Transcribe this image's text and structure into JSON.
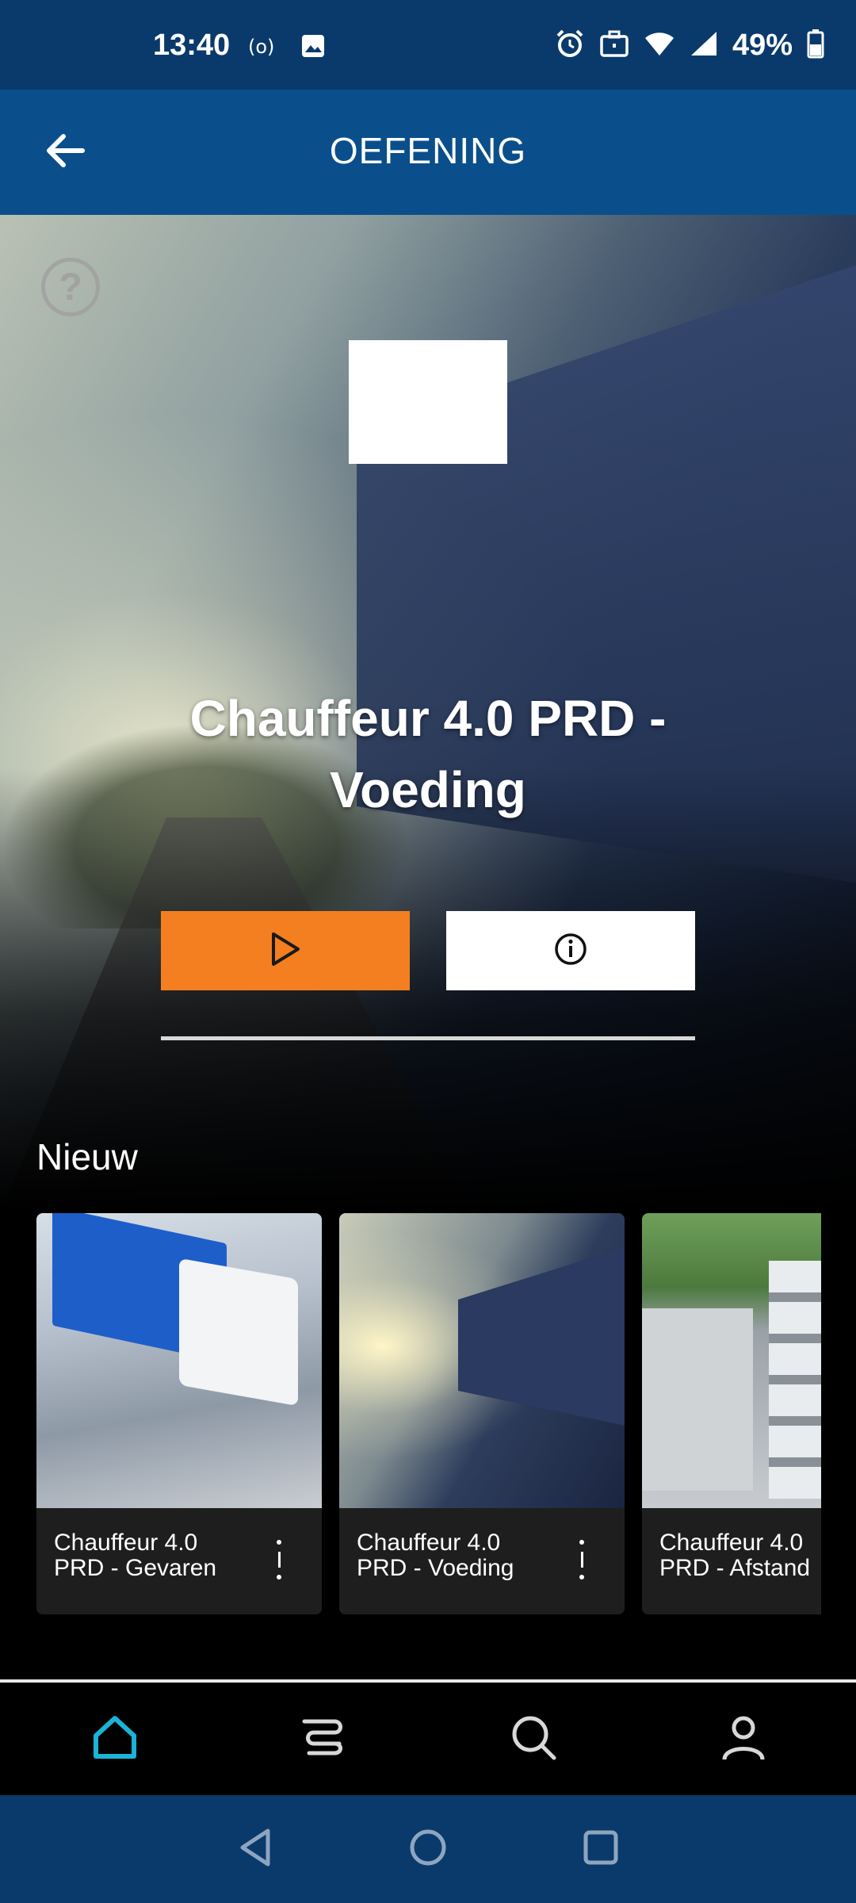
{
  "status_bar": {
    "time": "13:40",
    "battery": "49%",
    "icons": [
      "radio-icon",
      "image-icon",
      "alarm-icon",
      "briefcase-icon",
      "wifi-icon",
      "signal-icon",
      "battery-icon"
    ]
  },
  "app_bar": {
    "title": "OEFENING",
    "back_icon": "arrow-left-icon"
  },
  "hero": {
    "title": "Chauffeur 4.0 PRD - Voeding",
    "help_icon": "question-circle-icon",
    "play_icon": "play-icon",
    "info_icon": "info-circle-icon",
    "accent_color": "#f47f20"
  },
  "section": {
    "title": "Nieuw"
  },
  "cards": [
    {
      "title": "Chauffeur 4.0\nPRD - Gevaren"
    },
    {
      "title": "Chauffeur 4.0\nPRD - Voeding"
    },
    {
      "title": "Chauffeur 4.0\nPRD - Afstand"
    }
  ],
  "bottom_nav": {
    "items": [
      "home-icon",
      "library-icon",
      "search-icon",
      "profile-icon"
    ],
    "active_color": "#1bb3d6"
  },
  "system_nav": {
    "items": [
      "back-icon",
      "home-circle-icon",
      "recents-icon"
    ]
  }
}
